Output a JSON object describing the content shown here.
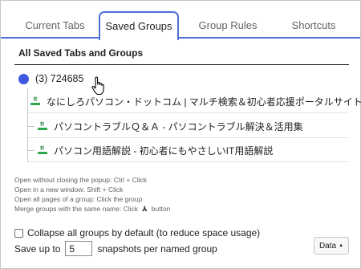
{
  "tabs": [
    {
      "label": "Current Tabs"
    },
    {
      "label": "Saved Groups"
    },
    {
      "label": "Group Rules"
    },
    {
      "label": "Shortcuts"
    }
  ],
  "section": {
    "title": "All Saved Tabs and Groups"
  },
  "group": {
    "name": "(3) 724685",
    "color": "#3f58e0"
  },
  "saved_tabs": [
    {
      "title": "なにしろパソコン・ドットコム | マルチ検索＆初心者応援ポータルサイト"
    },
    {
      "title": "パソコントラブルＱ＆Ａ - パソコントラブル解決＆活用集"
    },
    {
      "title": "パソコン用語解説 - 初心者にもやさしいIT用語解説"
    }
  ],
  "favicon_text": "初",
  "help": {
    "line1": "Open without closing the popup: Ctrl + Click",
    "line2": "Open in a new window: Shift + Click",
    "line3": "Open all pages of a group: Click the group",
    "line4_pre": "Merge groups with the same name: Click",
    "line4_post": "button"
  },
  "options": {
    "collapse_label": "Collapse all groups by default (to reduce space usage)",
    "save_prefix": "Save up to",
    "save_value": "5",
    "save_suffix": "snapshots per named group"
  },
  "data_button": {
    "label": "Data"
  }
}
